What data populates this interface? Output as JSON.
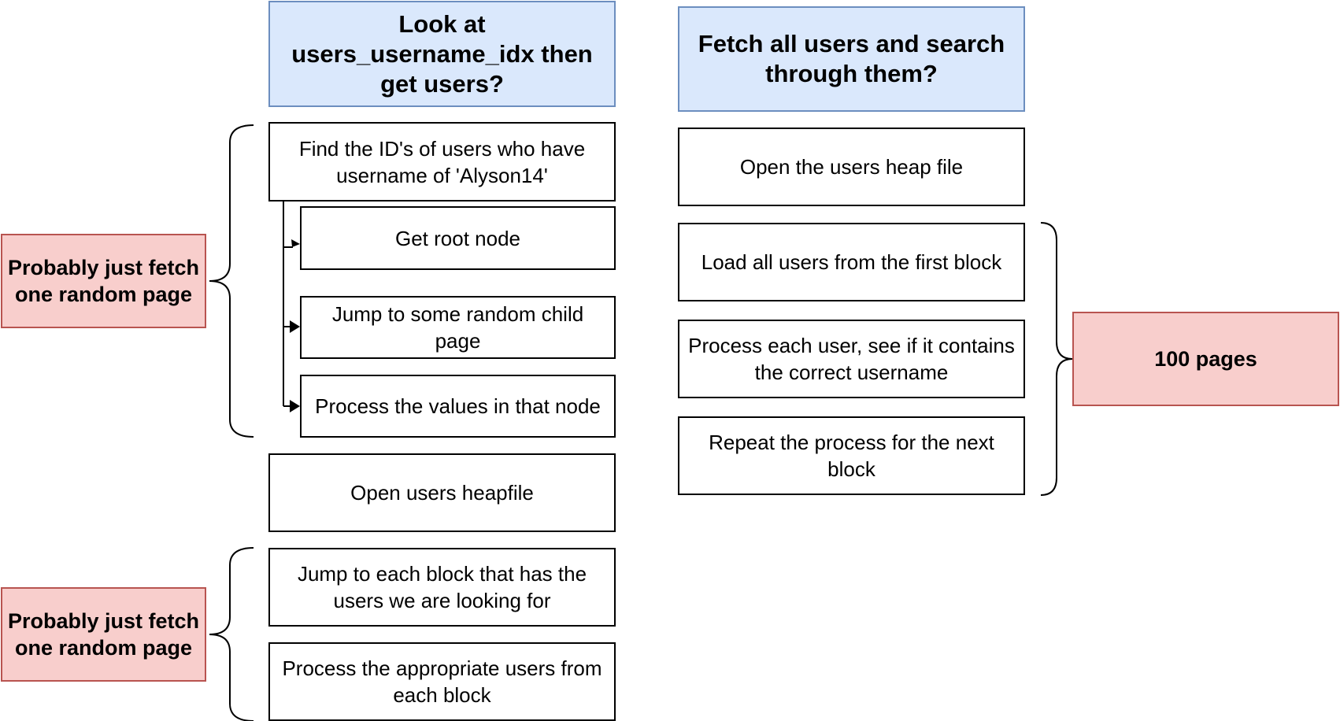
{
  "headers": {
    "index_path": "Look at users_username_idx then get users?",
    "heap_path": "Fetch all users and search through them?"
  },
  "index_steps": {
    "find_ids": "Find the ID's of users who have username of 'Alyson14'",
    "get_root": "Get root node",
    "jump_child": "Jump to some random child page",
    "process_node": "Process the values in that node",
    "open_heapfile": "Open users heapfile",
    "jump_block": "Jump to each block that has the users we are looking for",
    "process_users": "Process the appropriate users from each block"
  },
  "heap_steps": {
    "open_heap": "Open the users heap file",
    "load_first": "Load all users from the first block",
    "process_each": "Process each user, see if it contains the correct username",
    "repeat": "Repeat the process for the next block"
  },
  "notes": {
    "index_lookup": "Probably just fetch one random page",
    "heap_fetch": "Probably just fetch one random page",
    "full_scan": "100 pages"
  },
  "colors": {
    "header_fill": "#dae8fc",
    "header_stroke": "#6c8ebf",
    "note_fill": "#f8cecc",
    "note_stroke": "#b85450"
  }
}
